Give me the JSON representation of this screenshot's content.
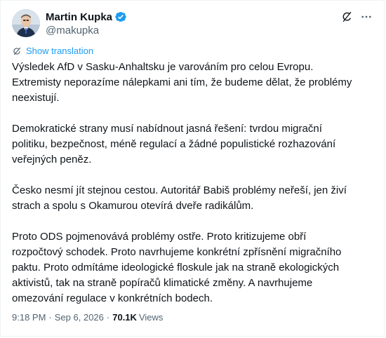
{
  "author": {
    "display_name": "Martin Kupka",
    "handle": "@makupka",
    "verified": true
  },
  "actions": {
    "grok_icon": "grok-icon",
    "more_icon": "more-icon"
  },
  "translation": {
    "label": "Show translation",
    "icon": "translate-icon"
  },
  "paragraphs": [
    "Výsledek AfD v Sasku-Anhaltsku je varováním pro celou Evropu.\nExtremisty neporazíme nálepkami ani tím, že budeme dělat, že problémy\nneexistují.",
    "Demokratické strany musí nabídnout jasná řešení: tvrdou migrační\npolitiku, bezpečnost, méně regulací a žádné populistické rozhazování\nveřejných peněz.",
    "Česko nesmí jít stejnou cestou. Autoritář Babiš problémy neřeší, jen živí\nstrach a spolu s Okamurou otevírá dveře radikálům.",
    "Proto ODS pojmenovává problémy ostře. Proto kritizujeme obří\nrozpočtový schodek. Proto navrhujeme konkrétní zpřísnění migračního\npaktu. Proto odmítáme ideologické floskule jak na straně ekologických\naktivistů, tak na straně popíračů klimatické změny. A navrhujeme\nomezování regulace v konkrétních bodech."
  ],
  "meta": {
    "time": "9:18 PM",
    "separator": "·",
    "date": "Sep 6, 2026",
    "views_count": "70.1K",
    "views_label": "Views"
  },
  "colors": {
    "accent": "#1d9bf0",
    "text": "#0f1419",
    "secondary": "#536471"
  }
}
